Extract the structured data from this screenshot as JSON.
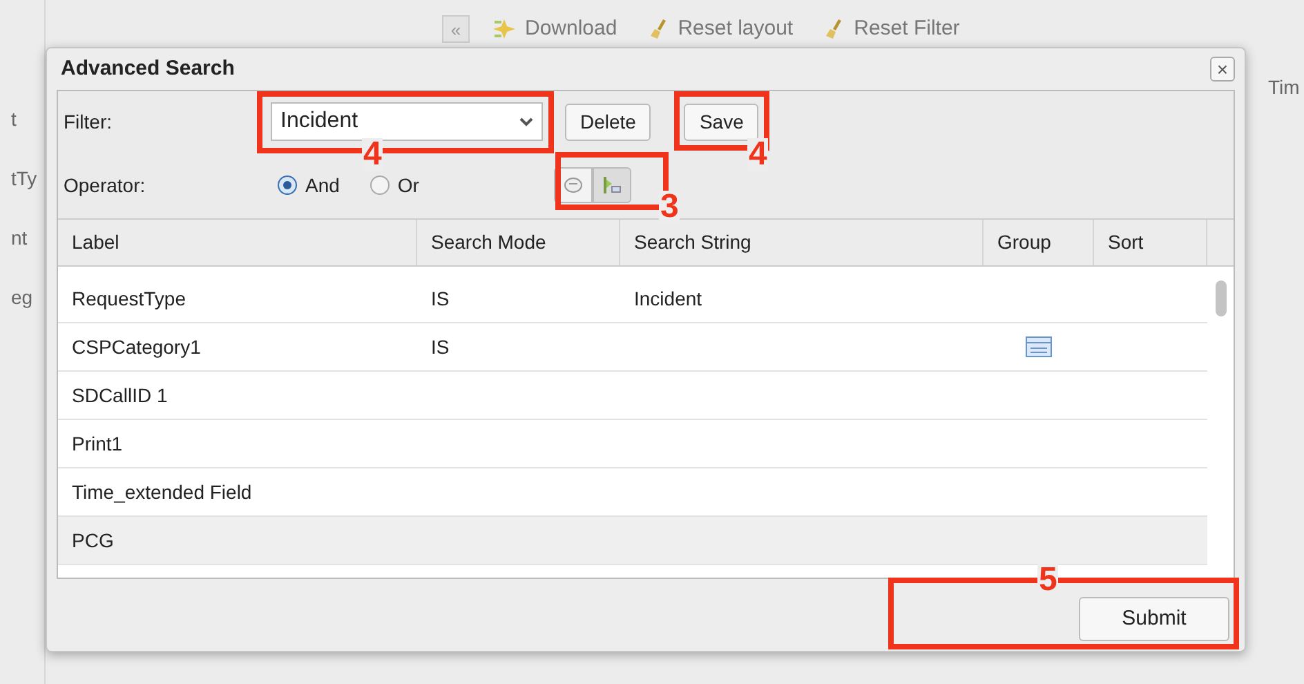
{
  "toolbar": {
    "collapse": "«",
    "buttons": [
      {
        "label": "Download",
        "kind": "download"
      },
      {
        "label": "Reset layout",
        "kind": "broom"
      },
      {
        "label": "Reset Filter",
        "kind": "broom"
      }
    ]
  },
  "background": {
    "left_fragments": [
      "t",
      "tTy",
      "nt",
      "eg"
    ],
    "right_fragment": "Tim"
  },
  "dialog": {
    "title": "Advanced Search",
    "close": "×",
    "filter": {
      "label": "Filter:",
      "value": "Incident",
      "buttons": [
        "Delete",
        "Save"
      ]
    },
    "operator": {
      "label": "Operator:",
      "options": [
        {
          "label": "And",
          "selected": true
        },
        {
          "label": "Or",
          "selected": false
        }
      ]
    },
    "table": {
      "columns": [
        "Label",
        "Search Mode",
        "Search String",
        "Group",
        "Sort"
      ],
      "rows": [
        {
          "label": "RequestType",
          "mode": "IS",
          "string": "Incident",
          "group": false
        },
        {
          "label": "CSPCategory1",
          "mode": "IS",
          "string": "",
          "group": true
        },
        {
          "label": "SDCallID 1",
          "mode": "",
          "string": "",
          "group": false
        },
        {
          "label": "Print1",
          "mode": "",
          "string": "",
          "group": false
        },
        {
          "label": "Time_extended Field",
          "mode": "",
          "string": "",
          "group": false
        },
        {
          "label": "PCG",
          "mode": "",
          "string": "",
          "group": false
        }
      ]
    },
    "submit": "Submit"
  },
  "annotations": [
    {
      "number": "4"
    },
    {
      "number": "4"
    },
    {
      "number": "3"
    },
    {
      "number": "5"
    }
  ]
}
